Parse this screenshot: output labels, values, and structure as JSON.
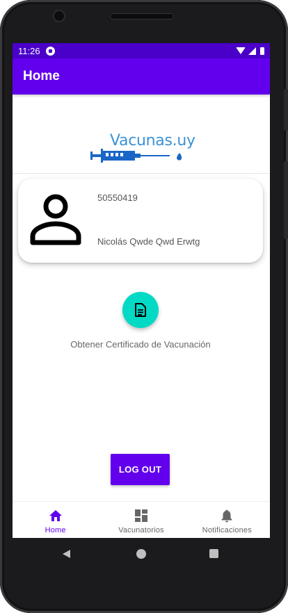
{
  "status_bar": {
    "time": "11:26"
  },
  "app_bar": {
    "title": "Home"
  },
  "logo": {
    "text": "Vacunas.uy"
  },
  "user": {
    "id": "50550419",
    "name": "Nicolás Qwde Qwd Erwtg"
  },
  "certificate": {
    "label": "Obtener Certificado de Vacunación",
    "icon": "document-icon"
  },
  "logout": {
    "label": "LOG OUT"
  },
  "bottom_nav": {
    "items": [
      {
        "label": "Home",
        "icon": "home-icon",
        "active": true
      },
      {
        "label": "Vacunatorios",
        "icon": "dashboard-icon",
        "active": false
      },
      {
        "label": "Notificaciones",
        "icon": "bell-icon",
        "active": false
      }
    ]
  },
  "colors": {
    "primary": "#6200ee",
    "status_bar": "#4a00c8",
    "accent": "#03dac5",
    "logo_blue": "#3c92d6"
  }
}
